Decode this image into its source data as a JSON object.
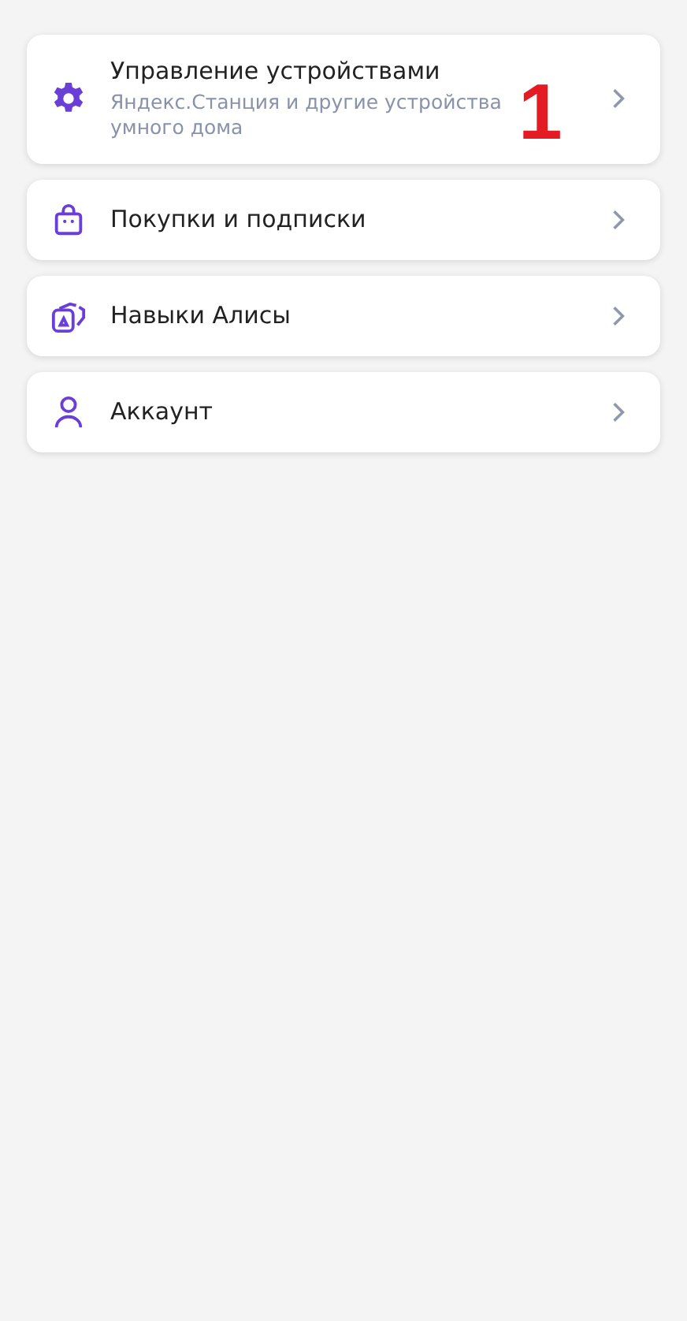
{
  "menu": [
    {
      "kind": "gear",
      "title": "Управление устройствами",
      "subtitle": "Яндекс.Станция и другие устройства умного дома",
      "marker": "1"
    },
    {
      "kind": "bag",
      "title": "Покупки и подписки"
    },
    {
      "kind": "skills",
      "title": "Навыки Алисы"
    },
    {
      "kind": "person",
      "title": "Аккаунт"
    }
  ]
}
